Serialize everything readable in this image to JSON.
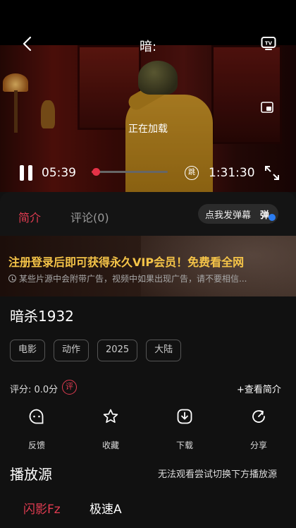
{
  "player": {
    "title": "暗:",
    "loading_text": "正在加载",
    "current_time": "05:39",
    "total_time": "1:31:30",
    "progress": 0.06,
    "skip_label": "跳"
  },
  "tabs": {
    "intro": "简介",
    "comments": "评论(0)",
    "danmu_button": "点我发弹幕",
    "danmu_icon": "弹"
  },
  "banner": {
    "title": "注册登录后即可获得永久VIP会员！免费看全网",
    "note": "某些片源中会附带广告，视频中如果出现广告，请不要相信..."
  },
  "movie": {
    "title": "暗杀1932",
    "tags": [
      "电影",
      "动作",
      "2025",
      "大陆"
    ],
    "rating": "评分: 0.0分",
    "rating_icon": "评",
    "view_intro": "+查看简介"
  },
  "actions": [
    {
      "label": "反馈",
      "icon": "feedback-icon"
    },
    {
      "label": "收藏",
      "icon": "star-icon"
    },
    {
      "label": "下载",
      "icon": "download-icon"
    },
    {
      "label": "分享",
      "icon": "share-icon"
    }
  ],
  "sources": {
    "title": "播放源",
    "hint": "无法观看尝试切换下方播放源",
    "items": [
      "闪影Fz",
      "极速A"
    ]
  },
  "colors": {
    "accent": "#e23c51",
    "banner_text": "#f5c448",
    "background": "#111111"
  }
}
